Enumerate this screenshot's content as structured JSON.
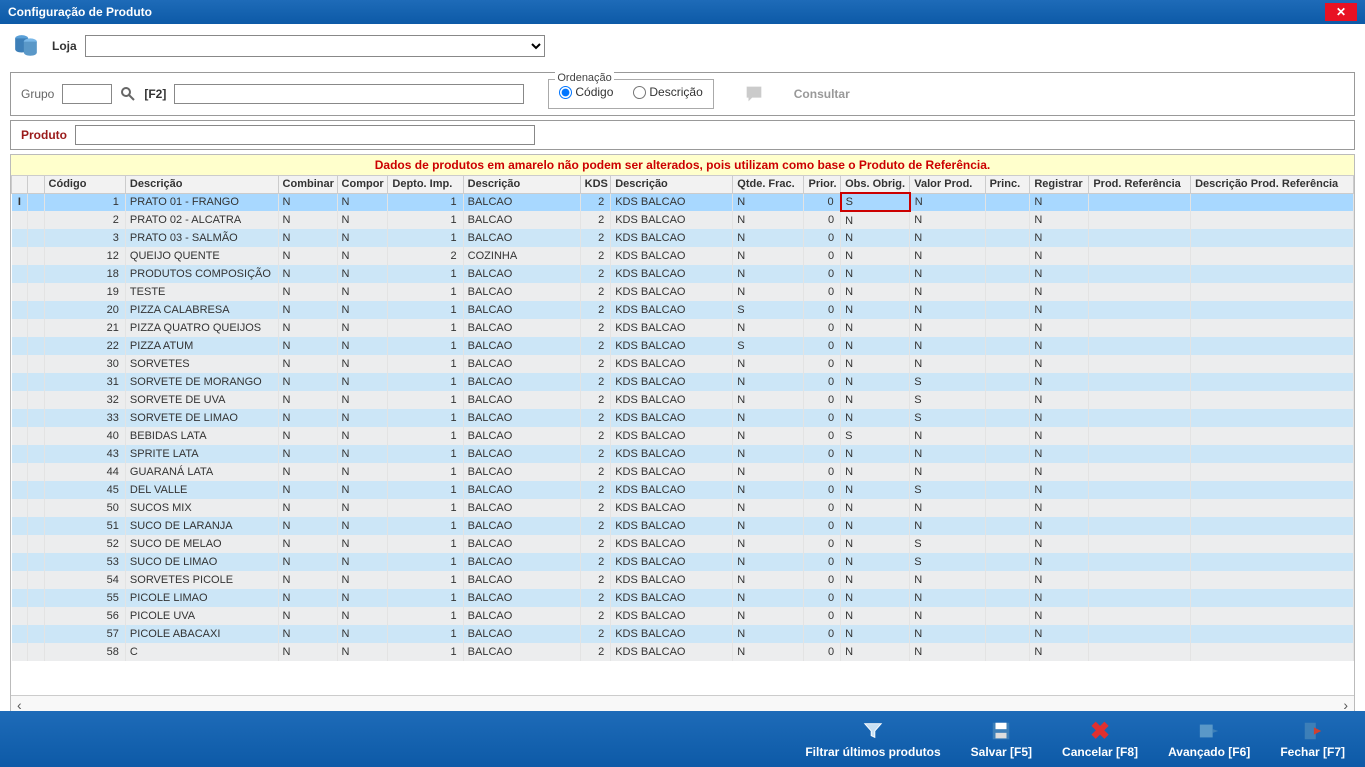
{
  "title": "Configuração de Produto",
  "loja_label": "Loja",
  "grupo_label": "Grupo",
  "f2_label": "[F2]",
  "ordenacao_label": "Ordenação",
  "ord_codigo": "Código",
  "ord_descricao": "Descrição",
  "consultar": "Consultar",
  "produto_label": "Produto",
  "warning": "Dados de produtos em amarelo não podem ser alterados, pois utilizam como base o Produto de Referência.",
  "columns": {
    "codigo": "Código",
    "descricao": "Descrição",
    "combinar": "Combinar",
    "compor": "Compor",
    "depto": "Depto. Imp.",
    "desc2": "Descrição",
    "kds": "KDS",
    "desc3": "Descrição",
    "qtde": "Qtde. Frac.",
    "prior": "Prior.",
    "obs": "Obs. Obrig.",
    "valor": "Valor Prod.",
    "princ": "Princ.",
    "reg": "Registrar",
    "prodref": "Prod. Referência",
    "descref": "Descrição Prod. Referência"
  },
  "edit_cell_value": "S",
  "rows": [
    {
      "codigo": 1,
      "descricao": "PRATO 01 - FRANGO",
      "combinar": "N",
      "compor": "N",
      "depto": 1,
      "desc2": "BALCAO",
      "kds": 2,
      "desc3": "KDS BALCAO",
      "qtde": "N",
      "prior": 0,
      "obs": "",
      "valor": "N",
      "reg": "N",
      "selected": true,
      "editing": true
    },
    {
      "codigo": 2,
      "descricao": "PRATO 02 - ALCATRA",
      "combinar": "N",
      "compor": "N",
      "depto": 1,
      "desc2": "BALCAO",
      "kds": 2,
      "desc3": "KDS BALCAO",
      "qtde": "N",
      "prior": 0,
      "obs": "N",
      "valor": "N",
      "reg": "N"
    },
    {
      "codigo": 3,
      "descricao": "PRATO 03 - SALMÃO",
      "combinar": "N",
      "compor": "N",
      "depto": 1,
      "desc2": "BALCAO",
      "kds": 2,
      "desc3": "KDS BALCAO",
      "qtde": "N",
      "prior": 0,
      "obs": "N",
      "valor": "N",
      "reg": "N"
    },
    {
      "codigo": 12,
      "descricao": "QUEIJO QUENTE",
      "combinar": "N",
      "compor": "N",
      "depto": 2,
      "desc2": "COZINHA",
      "kds": 2,
      "desc3": "KDS BALCAO",
      "qtde": "N",
      "prior": 0,
      "obs": "N",
      "valor": "N",
      "reg": "N"
    },
    {
      "codigo": 18,
      "descricao": "PRODUTOS COMPOSIÇÃO",
      "combinar": "N",
      "compor": "N",
      "depto": 1,
      "desc2": "BALCAO",
      "kds": 2,
      "desc3": "KDS BALCAO",
      "qtde": "N",
      "prior": 0,
      "obs": "N",
      "valor": "N",
      "reg": "N"
    },
    {
      "codigo": 19,
      "descricao": "TESTE",
      "combinar": "N",
      "compor": "N",
      "depto": 1,
      "desc2": "BALCAO",
      "kds": 2,
      "desc3": "KDS BALCAO",
      "qtde": "N",
      "prior": 0,
      "obs": "N",
      "valor": "N",
      "reg": "N"
    },
    {
      "codigo": 20,
      "descricao": "PIZZA CALABRESA",
      "combinar": "N",
      "compor": "N",
      "depto": 1,
      "desc2": "BALCAO",
      "kds": 2,
      "desc3": "KDS BALCAO",
      "qtde": "S",
      "prior": 0,
      "obs": "N",
      "valor": "N",
      "reg": "N"
    },
    {
      "codigo": 21,
      "descricao": "PIZZA QUATRO QUEIJOS",
      "combinar": "N",
      "compor": "N",
      "depto": 1,
      "desc2": "BALCAO",
      "kds": 2,
      "desc3": "KDS BALCAO",
      "qtde": "N",
      "prior": 0,
      "obs": "N",
      "valor": "N",
      "reg": "N"
    },
    {
      "codigo": 22,
      "descricao": "PIZZA ATUM",
      "combinar": "N",
      "compor": "N",
      "depto": 1,
      "desc2": "BALCAO",
      "kds": 2,
      "desc3": "KDS BALCAO",
      "qtde": "S",
      "prior": 0,
      "obs": "N",
      "valor": "N",
      "reg": "N"
    },
    {
      "codigo": 30,
      "descricao": "SORVETES",
      "combinar": "N",
      "compor": "N",
      "depto": 1,
      "desc2": "BALCAO",
      "kds": 2,
      "desc3": "KDS BALCAO",
      "qtde": "N",
      "prior": 0,
      "obs": "N",
      "valor": "N",
      "reg": "N"
    },
    {
      "codigo": 31,
      "descricao": "SORVETE DE MORANGO",
      "combinar": "N",
      "compor": "N",
      "depto": 1,
      "desc2": "BALCAO",
      "kds": 2,
      "desc3": "KDS BALCAO",
      "qtde": "N",
      "prior": 0,
      "obs": "N",
      "valor": "S",
      "reg": "N"
    },
    {
      "codigo": 32,
      "descricao": "SORVETE DE UVA",
      "combinar": "N",
      "compor": "N",
      "depto": 1,
      "desc2": "BALCAO",
      "kds": 2,
      "desc3": "KDS BALCAO",
      "qtde": "N",
      "prior": 0,
      "obs": "N",
      "valor": "S",
      "reg": "N"
    },
    {
      "codigo": 33,
      "descricao": "SORVETE DE LIMAO",
      "combinar": "N",
      "compor": "N",
      "depto": 1,
      "desc2": "BALCAO",
      "kds": 2,
      "desc3": "KDS BALCAO",
      "qtde": "N",
      "prior": 0,
      "obs": "N",
      "valor": "S",
      "reg": "N"
    },
    {
      "codigo": 40,
      "descricao": "BEBIDAS LATA",
      "combinar": "N",
      "compor": "N",
      "depto": 1,
      "desc2": "BALCAO",
      "kds": 2,
      "desc3": "KDS BALCAO",
      "qtde": "N",
      "prior": 0,
      "obs": "S",
      "valor": "N",
      "reg": "N"
    },
    {
      "codigo": 43,
      "descricao": "SPRITE LATA",
      "combinar": "N",
      "compor": "N",
      "depto": 1,
      "desc2": "BALCAO",
      "kds": 2,
      "desc3": "KDS BALCAO",
      "qtde": "N",
      "prior": 0,
      "obs": "N",
      "valor": "N",
      "reg": "N"
    },
    {
      "codigo": 44,
      "descricao": "GUARANÁ LATA",
      "combinar": "N",
      "compor": "N",
      "depto": 1,
      "desc2": "BALCAO",
      "kds": 2,
      "desc3": "KDS BALCAO",
      "qtde": "N",
      "prior": 0,
      "obs": "N",
      "valor": "N",
      "reg": "N"
    },
    {
      "codigo": 45,
      "descricao": "DEL VALLE",
      "combinar": "N",
      "compor": "N",
      "depto": 1,
      "desc2": "BALCAO",
      "kds": 2,
      "desc3": "KDS BALCAO",
      "qtde": "N",
      "prior": 0,
      "obs": "N",
      "valor": "S",
      "reg": "N"
    },
    {
      "codigo": 50,
      "descricao": "SUCOS MIX",
      "combinar": "N",
      "compor": "N",
      "depto": 1,
      "desc2": "BALCAO",
      "kds": 2,
      "desc3": "KDS BALCAO",
      "qtde": "N",
      "prior": 0,
      "obs": "N",
      "valor": "N",
      "reg": "N"
    },
    {
      "codigo": 51,
      "descricao": "SUCO DE LARANJA",
      "combinar": "N",
      "compor": "N",
      "depto": 1,
      "desc2": "BALCAO",
      "kds": 2,
      "desc3": "KDS BALCAO",
      "qtde": "N",
      "prior": 0,
      "obs": "N",
      "valor": "N",
      "reg": "N"
    },
    {
      "codigo": 52,
      "descricao": "SUCO DE MELAO",
      "combinar": "N",
      "compor": "N",
      "depto": 1,
      "desc2": "BALCAO",
      "kds": 2,
      "desc3": "KDS BALCAO",
      "qtde": "N",
      "prior": 0,
      "obs": "N",
      "valor": "S",
      "reg": "N"
    },
    {
      "codigo": 53,
      "descricao": "SUCO DE LIMAO",
      "combinar": "N",
      "compor": "N",
      "depto": 1,
      "desc2": "BALCAO",
      "kds": 2,
      "desc3": "KDS BALCAO",
      "qtde": "N",
      "prior": 0,
      "obs": "N",
      "valor": "S",
      "reg": "N"
    },
    {
      "codigo": 54,
      "descricao": "SORVETES PICOLE",
      "combinar": "N",
      "compor": "N",
      "depto": 1,
      "desc2": "BALCAO",
      "kds": 2,
      "desc3": "KDS BALCAO",
      "qtde": "N",
      "prior": 0,
      "obs": "N",
      "valor": "N",
      "reg": "N"
    },
    {
      "codigo": 55,
      "descricao": "PICOLE LIMAO",
      "combinar": "N",
      "compor": "N",
      "depto": 1,
      "desc2": "BALCAO",
      "kds": 2,
      "desc3": "KDS BALCAO",
      "qtde": "N",
      "prior": 0,
      "obs": "N",
      "valor": "N",
      "reg": "N"
    },
    {
      "codigo": 56,
      "descricao": "PICOLE UVA",
      "combinar": "N",
      "compor": "N",
      "depto": 1,
      "desc2": "BALCAO",
      "kds": 2,
      "desc3": "KDS BALCAO",
      "qtde": "N",
      "prior": 0,
      "obs": "N",
      "valor": "N",
      "reg": "N"
    },
    {
      "codigo": 57,
      "descricao": "PICOLE ABACAXI",
      "combinar": "N",
      "compor": "N",
      "depto": 1,
      "desc2": "BALCAO",
      "kds": 2,
      "desc3": "KDS BALCAO",
      "qtde": "N",
      "prior": 0,
      "obs": "N",
      "valor": "N",
      "reg": "N"
    },
    {
      "codigo": 58,
      "descricao": "C",
      "combinar": "N",
      "compor": "N",
      "depto": 1,
      "desc2": "BALCAO",
      "kds": 2,
      "desc3": "KDS BALCAO",
      "qtde": "N",
      "prior": 0,
      "obs": "N",
      "valor": "N",
      "reg": "N"
    }
  ],
  "footer": {
    "filtrar": "Filtrar últimos produtos",
    "salvar": "Salvar [F5]",
    "cancelar": "Cancelar [F8]",
    "avancado": "Avançado [F6]",
    "fechar": "Fechar [F7]"
  }
}
